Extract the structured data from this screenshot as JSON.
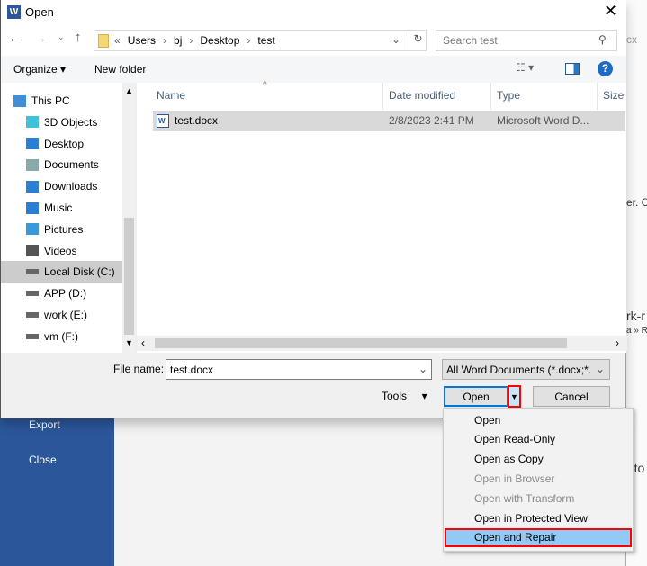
{
  "background": {
    "snippets": [
      "cx",
      "er. Cl",
      "rk-r",
      "a » R",
      "-to"
    ],
    "backstage": [
      "Export",
      "Close"
    ]
  },
  "dialog": {
    "title": "Open",
    "address": {
      "overflow": "«",
      "crumbs": [
        "Users",
        "bj",
        "Desktop",
        "test"
      ]
    },
    "search_placeholder": "Search test",
    "toolbar": {
      "organize": "Organize",
      "new_folder": "New folder"
    },
    "nav": [
      {
        "label": "This PC",
        "icon": "computer-icon"
      },
      {
        "label": "3D Objects",
        "icon": "cube-icon"
      },
      {
        "label": "Desktop",
        "icon": "desktop-icon"
      },
      {
        "label": "Documents",
        "icon": "documents-icon"
      },
      {
        "label": "Downloads",
        "icon": "download-icon"
      },
      {
        "label": "Music",
        "icon": "music-icon"
      },
      {
        "label": "Pictures",
        "icon": "pictures-icon"
      },
      {
        "label": "Videos",
        "icon": "videos-icon"
      },
      {
        "label": "Local Disk (C:)",
        "icon": "drive-icon",
        "selected": true
      },
      {
        "label": "APP (D:)",
        "icon": "drive-icon"
      },
      {
        "label": "work (E:)",
        "icon": "drive-icon"
      },
      {
        "label": "vm (F:)",
        "icon": "drive-icon"
      }
    ],
    "columns": [
      "Name",
      "Date modified",
      "Type",
      "Size"
    ],
    "files": [
      {
        "name": "test.docx",
        "date": "2/8/2023 2:41 PM",
        "type": "Microsoft Word D..."
      }
    ],
    "file_name_label": "File name:",
    "file_name_value": "test.docx",
    "file_type": "All Word Documents (*.docx;*.c",
    "tools": "Tools",
    "open": "Open",
    "cancel": "Cancel",
    "open_menu": [
      {
        "label": "Open",
        "enabled": true
      },
      {
        "label": "Open Read-Only",
        "enabled": true
      },
      {
        "label": "Open as Copy",
        "enabled": true
      },
      {
        "label": "Open in Browser",
        "enabled": false
      },
      {
        "label": "Open with Transform",
        "enabled": false
      },
      {
        "label": "Open in Protected View",
        "enabled": true
      },
      {
        "label": "Open and Repair",
        "enabled": true,
        "highlighted": true
      }
    ]
  },
  "colors": {
    "accent": "#2b579a",
    "highlight": "#91c9f7",
    "annotation": "#ff0000"
  }
}
